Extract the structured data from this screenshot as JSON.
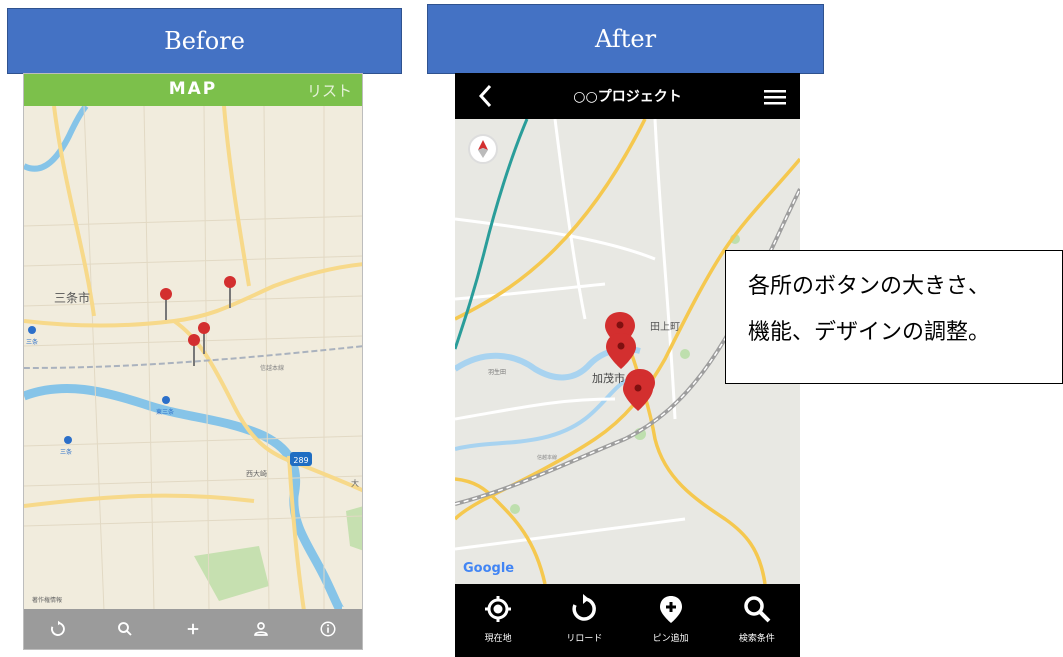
{
  "labels": {
    "before": "Before",
    "after": "After"
  },
  "before": {
    "header_title": "MAP",
    "header_right": "リスト",
    "map_labels": {
      "city": "三条市",
      "station1": "東三条",
      "station2": "三条",
      "station3": "三条",
      "district": "西大崎",
      "railway": "信越本線",
      "road_number": "289",
      "edge_right": "大",
      "attribution": "著作権情報"
    },
    "toolbar_icons": [
      "reload-icon",
      "search-icon",
      "plus-icon",
      "user-icon",
      "info-icon"
    ]
  },
  "after": {
    "header_title": "○○プロジェクト",
    "map_labels": {
      "town": "加茂市",
      "area1": "田上町",
      "area2": "羽生田",
      "railway": "信越本線"
    },
    "google": "Google",
    "toolbar": [
      {
        "icon": "current-location-icon",
        "label": "現在地"
      },
      {
        "icon": "reload-icon",
        "label": "リロード"
      },
      {
        "icon": "add-pin-icon",
        "label": "ピン追加"
      },
      {
        "icon": "search-icon",
        "label": "検索条件"
      }
    ]
  },
  "callout": {
    "line1": "各所のボタンの大きさ、",
    "line2": "機能、デザインの調整。"
  },
  "colors": {
    "label_bg": "#4472c4",
    "before_header": "#7cc04b",
    "before_toolbar": "#9b9b9b",
    "after_bar": "#000000",
    "pin": "#d32f2f"
  }
}
